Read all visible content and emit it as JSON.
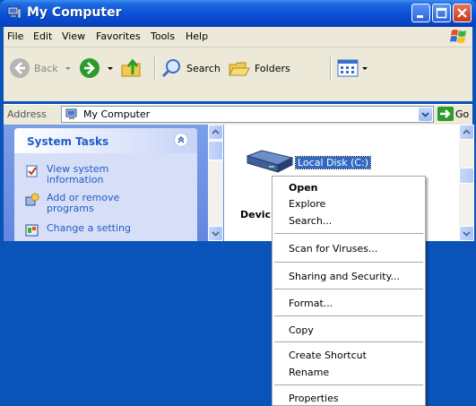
{
  "window": {
    "title": "My Computer"
  },
  "menubar": {
    "items": [
      "File",
      "Edit",
      "View",
      "Favorites",
      "Tools",
      "Help"
    ]
  },
  "toolbar": {
    "back_label": "Back",
    "search_label": "Search",
    "folders_label": "Folders"
  },
  "address": {
    "label": "Address",
    "value": "My Computer",
    "go_label": "Go"
  },
  "tasks": {
    "title": "System Tasks",
    "items": [
      {
        "line1": "View system",
        "line2": "information"
      },
      {
        "line1": "Add or remove",
        "line2": "programs"
      },
      {
        "line1": "Change a setting",
        "line2": ""
      }
    ]
  },
  "content": {
    "disk_label": "Local Disk (C:)",
    "group_header": "Devic"
  },
  "context_menu": {
    "items": [
      "Open",
      "Explore",
      "Search...",
      "Scan for Viruses...",
      "Sharing and Security...",
      "Format...",
      "Copy",
      "Create Shortcut",
      "Rename",
      "Properties"
    ]
  },
  "colors": {
    "titlebar": "#0a4fd6",
    "selection": "#316ac5",
    "task_link": "#215dc6"
  }
}
